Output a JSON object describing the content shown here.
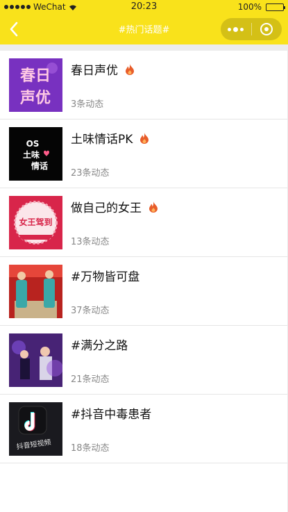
{
  "status_bar": {
    "carrier": "WeChat",
    "time": "20:23",
    "battery": "100%",
    "battery_level": 1.0
  },
  "navbar": {
    "title": "#热门话题#",
    "back_icon": "chevron-left-icon",
    "more_icon": "more-dots-icon",
    "close_icon": "target-ring-icon"
  },
  "colors": {
    "header_bg": "#f9e21b",
    "hot_icon": "#e85d2a",
    "count_text": "#888888"
  },
  "topics": [
    {
      "title": "春日声优",
      "count": "3条动态",
      "hot": true,
      "thumb": "春日声优 purple tile"
    },
    {
      "title": "土味情话PK",
      "count": "23条动态",
      "hot": true,
      "thumb": "土味情话 black tile"
    },
    {
      "title": "做自己的女王",
      "count": "13条动态",
      "hot": true,
      "thumb": "女王驾到 red badge"
    },
    {
      "title": "#万物皆可盘",
      "count": "37条动态",
      "hot": false,
      "thumb": "crosstalk stage photo"
    },
    {
      "title": "#满分之路",
      "count": "21条动态",
      "hot": false,
      "thumb": "concert crowd photo"
    },
    {
      "title": "#抖音中毒患者",
      "count": "18条动态",
      "hot": false,
      "thumb": "douyin logo tile"
    }
  ],
  "thumb_text": {
    "spring_line1": "春日",
    "spring_line2": "声优",
    "earthy_line1": "OS",
    "earthy_line2": "土味",
    "earthy_line3": "情话",
    "queen_big": "女王驾到",
    "douyin_caption": "抖音短视频"
  }
}
